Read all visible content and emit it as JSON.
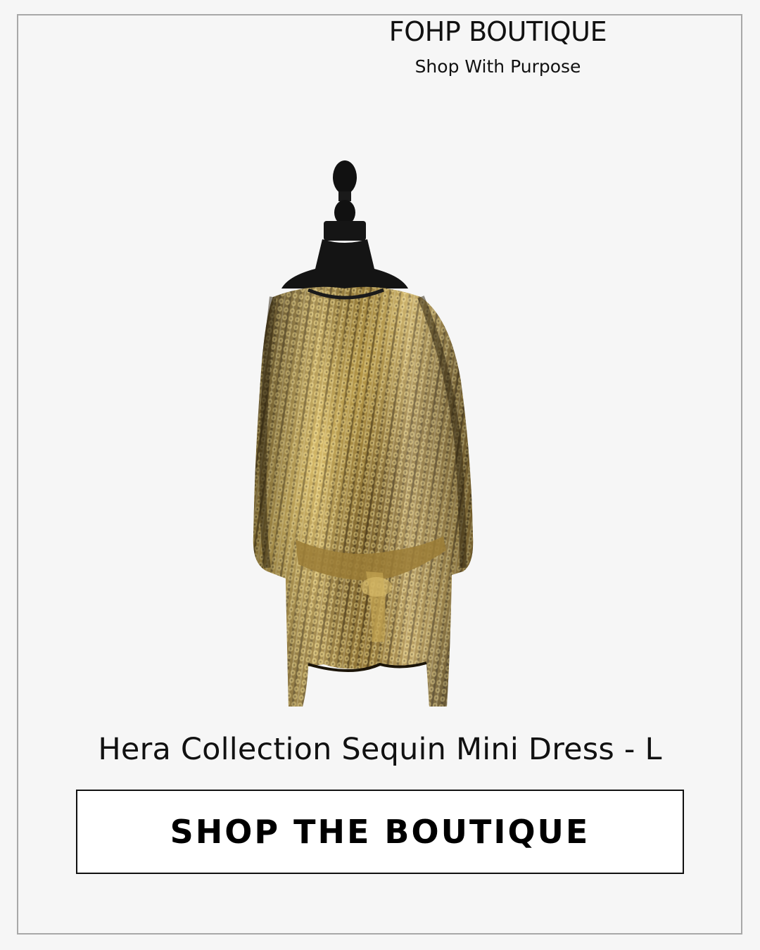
{
  "brand": {
    "title": "FOHP BOUTIQUE",
    "tagline": "Shop With Purpose"
  },
  "product": {
    "image_icon": "sequin-dress-on-mannequin-icon",
    "name": "Hera Collection Sequin Mini Dress - L"
  },
  "cta": {
    "label": "SHOP THE BOUTIQUE"
  },
  "colors": {
    "background": "#f6f6f6",
    "frame_border": "#a8a8a8",
    "text": "#111111",
    "button_bg": "#ffffff",
    "button_border": "#111111",
    "sequin_gold": "#b49545",
    "mannequin": "#111111"
  }
}
